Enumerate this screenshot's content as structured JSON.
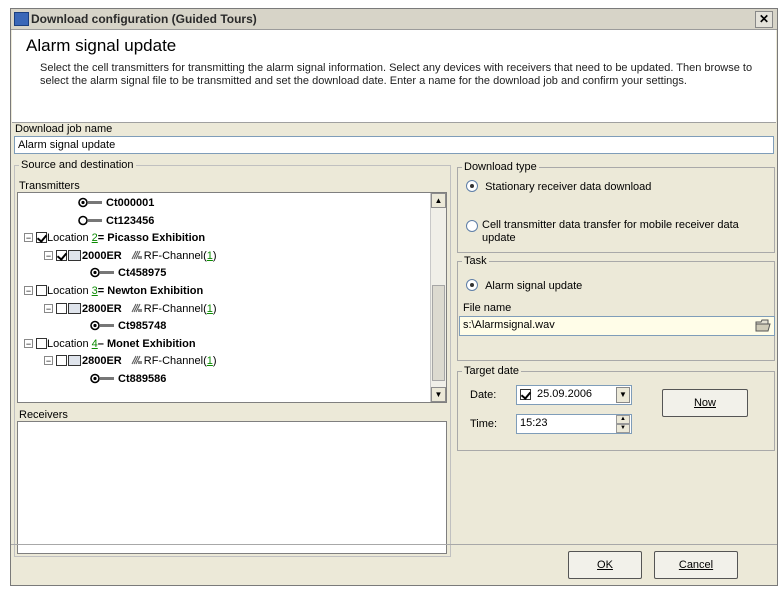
{
  "window": {
    "title": "Download configuration (Guided Tours)",
    "close_label": "✕"
  },
  "header": {
    "heading": "Alarm signal update",
    "description": "Select the cell transmitters for transmitting the alarm signal information. Select any devices with receivers that need to be updated. Then browse to select the alarm signal file to be transmitted and set the download date. Enter a name for the download job and confirm your settings."
  },
  "job": {
    "label": "Download job name",
    "value": "Alarm signal update"
  },
  "source": {
    "group_label": "Source and destination",
    "transmitters_label": "Transmitters",
    "tree": [
      {
        "indent": 1,
        "kind": "transmitter",
        "label": "Ct000001"
      },
      {
        "indent": 1,
        "kind": "transmitter-hollow",
        "label": "Ct123456"
      },
      {
        "indent": 0,
        "kind": "location",
        "checked": true,
        "prefix": "Location ",
        "number": "2",
        "name": "= Picasso Exhibition"
      },
      {
        "indent": 1,
        "kind": "device",
        "checked": true,
        "device": "2000ER",
        "channel": "RF-Channel",
        "channel_num": "1"
      },
      {
        "indent": 2,
        "kind": "transmitter",
        "label": "Ct458975"
      },
      {
        "indent": 0,
        "kind": "location",
        "checked": false,
        "prefix": "Location ",
        "number": "3",
        "name": "= Newton Exhibition"
      },
      {
        "indent": 1,
        "kind": "device",
        "checked": false,
        "device": "2800ER",
        "channel": "RF-Channel",
        "channel_num": "1"
      },
      {
        "indent": 2,
        "kind": "transmitter",
        "label": "Ct985748"
      },
      {
        "indent": 0,
        "kind": "location",
        "checked": false,
        "prefix": "Location ",
        "number": "4",
        "name": "– Monet Exhibition"
      },
      {
        "indent": 1,
        "kind": "device",
        "checked": false,
        "device": "2800ER",
        "channel": "RF-Channel",
        "channel_num": "1"
      },
      {
        "indent": 2,
        "kind": "transmitter",
        "label": "Ct889586"
      }
    ],
    "receivers_label": "Receivers"
  },
  "download_type": {
    "group_label": "Download type",
    "options": [
      {
        "label": "Stationary receiver data download",
        "selected": true
      },
      {
        "label": "Cell transmitter data transfer for mobile receiver data update",
        "selected": false
      }
    ]
  },
  "task": {
    "group_label": "Task",
    "option_label": "Alarm signal update",
    "file_label": "File name",
    "file_value": "s:\\Alarmsignal.wav",
    "browse_icon": "folder-browse-icon"
  },
  "target_date": {
    "group_label": "Target date",
    "date_label": "Date:",
    "date_value": "25.09.2006",
    "time_label": "Time:",
    "time_value": "15:23",
    "now_button": "Now"
  },
  "footer": {
    "ok_button": "OK",
    "cancel_button": "Cancel"
  },
  "colors": {
    "window_bg": "#ece9d8",
    "field_bg": "#fffde8",
    "link_green": "#0a8a00"
  }
}
